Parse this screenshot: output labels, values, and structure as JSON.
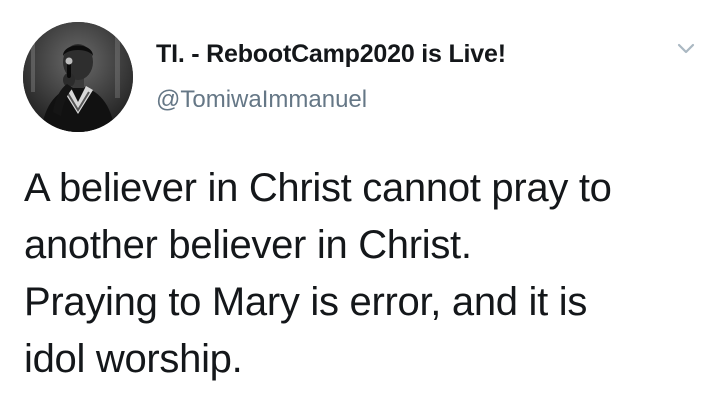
{
  "tweet": {
    "author": {
      "display_name": "TI. - RebootCamp2020 is Live!",
      "handle": "@TomiwaImmanuel",
      "avatar_icon": "profile-photo"
    },
    "menu_icon": "chevron-down-icon",
    "text_lines": [
      "A believer in Christ cannot pray to",
      "another believer in Christ.",
      "Praying to Mary is error, and it is",
      "idol worship."
    ]
  },
  "colors": {
    "text": "#14171a",
    "secondary_text": "#657786",
    "chevron": "#aab8c2",
    "background": "#ffffff"
  }
}
